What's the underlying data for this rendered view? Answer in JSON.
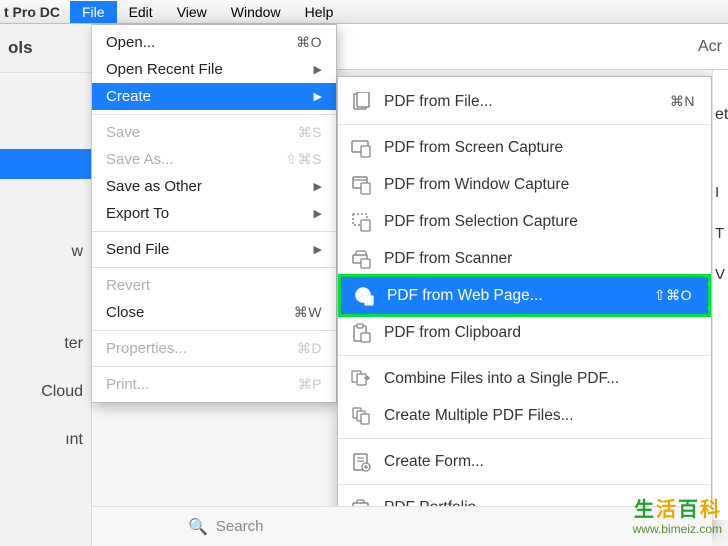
{
  "menubar": {
    "app_title": "t Pro DC",
    "items": [
      "File",
      "Edit",
      "View",
      "Window",
      "Help"
    ],
    "active_index": 0
  },
  "toolbar": {
    "right_text": "Acr"
  },
  "sidebar": {
    "header": "ols",
    "items": [
      "w",
      "ter",
      "Cloud",
      "ınt"
    ]
  },
  "file_menu": {
    "items": [
      {
        "label": "Open...",
        "shortcut": "⌘O",
        "type": "item"
      },
      {
        "label": "Open Recent File",
        "type": "submenu"
      },
      {
        "label": "Create",
        "type": "submenu",
        "selected": true
      },
      {
        "type": "sep"
      },
      {
        "label": "Save",
        "shortcut": "⌘S",
        "type": "item",
        "disabled": true
      },
      {
        "label": "Save As...",
        "shortcut": "⇧⌘S",
        "type": "item",
        "disabled": true
      },
      {
        "label": "Save as Other",
        "type": "submenu"
      },
      {
        "label": "Export To",
        "type": "submenu"
      },
      {
        "type": "sep"
      },
      {
        "label": "Send File",
        "type": "submenu"
      },
      {
        "type": "sep"
      },
      {
        "label": "Revert",
        "type": "item",
        "disabled": true
      },
      {
        "label": "Close",
        "shortcut": "⌘W",
        "type": "item"
      },
      {
        "type": "sep"
      },
      {
        "label": "Properties...",
        "shortcut": "⌘D",
        "type": "item",
        "disabled": true
      },
      {
        "type": "sep"
      },
      {
        "label": "Print...",
        "shortcut": "⌘P",
        "type": "item",
        "disabled": true
      }
    ]
  },
  "create_submenu": {
    "items": [
      {
        "label": "PDF from File...",
        "shortcut": "⌘N",
        "icon": "file"
      },
      {
        "type": "sep"
      },
      {
        "label": "PDF from Screen Capture",
        "icon": "screen"
      },
      {
        "label": "PDF from Window Capture",
        "icon": "window"
      },
      {
        "label": "PDF from Selection Capture",
        "icon": "selection"
      },
      {
        "label": "PDF from Scanner",
        "icon": "scanner"
      },
      {
        "label": "PDF from Web Page...",
        "shortcut": "⇧⌘O",
        "icon": "web",
        "highlight": true
      },
      {
        "label": "PDF from Clipboard",
        "icon": "clipboard"
      },
      {
        "type": "sep"
      },
      {
        "label": "Combine Files into a Single PDF...",
        "icon": "combine"
      },
      {
        "label": "Create Multiple PDF Files...",
        "icon": "multiple"
      },
      {
        "type": "sep"
      },
      {
        "label": "Create Form...",
        "icon": "form"
      },
      {
        "type": "sep"
      },
      {
        "label": "PDF Portfolio...",
        "icon": "portfolio"
      }
    ]
  },
  "right_panel": {
    "top_fragment": "et",
    "letters": [
      "I",
      "T",
      "V"
    ]
  },
  "search": {
    "placeholder": "Search"
  },
  "watermark": {
    "chars": [
      "生",
      "活",
      "百",
      "科"
    ],
    "url": "www.bimeiz.com"
  }
}
